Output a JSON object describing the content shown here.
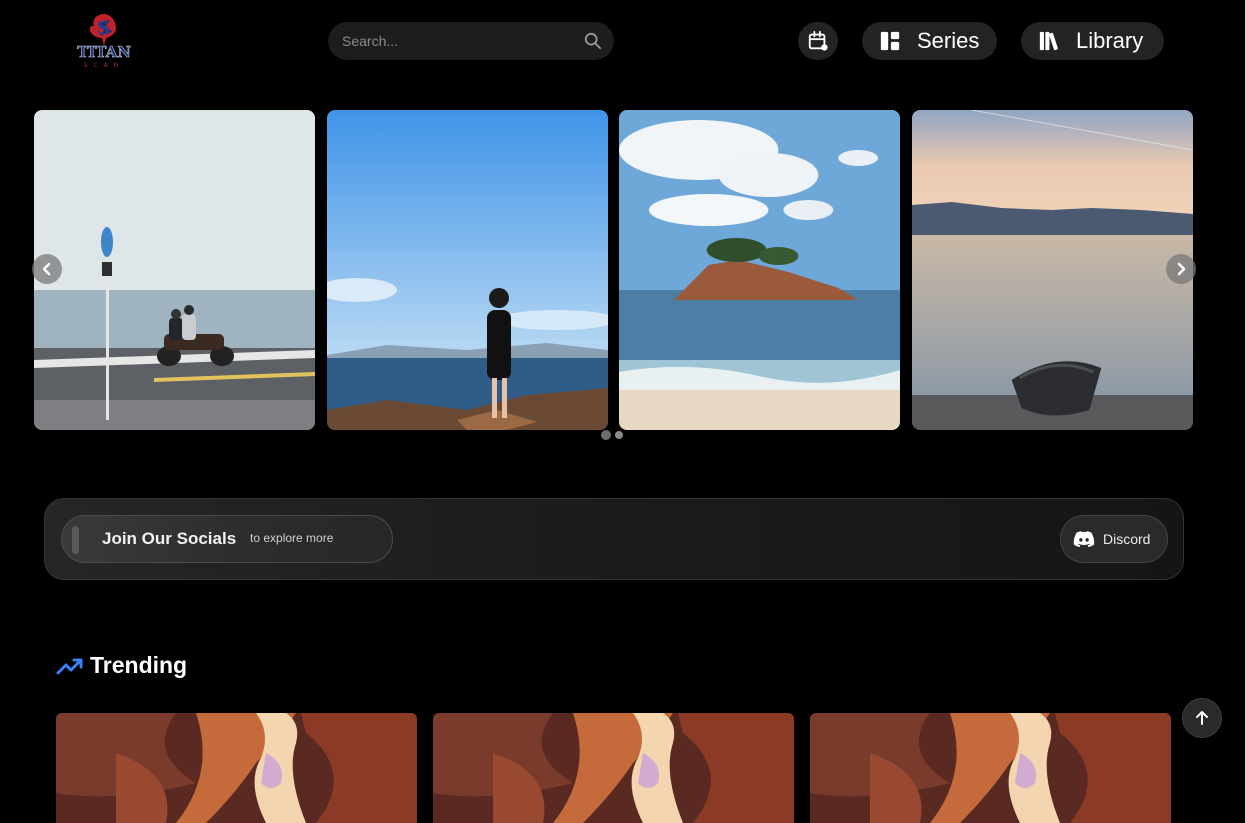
{
  "brand": {
    "logo_text": "TITAN",
    "logo_subtext": "SCAN",
    "logo_colors": {
      "red": "#c0222b",
      "navy": "#1b2f6b"
    }
  },
  "header": {
    "search": {
      "placeholder": "Search..."
    },
    "calendar_icon": "calendar-icon",
    "series_label": "Series",
    "library_label": "Library"
  },
  "carousel": {
    "slides": [
      {
        "subject": "motorcycle-by-sea"
      },
      {
        "subject": "woman-on-rocks"
      },
      {
        "subject": "island-beach"
      },
      {
        "subject": "boat-at-sunset"
      }
    ],
    "page_count": 2,
    "active_page": 1
  },
  "socials": {
    "title": "Join Our Socials",
    "hint": "to explore more",
    "discord_label": "Discord"
  },
  "trending": {
    "title": "Trending",
    "accent_color": "#3b82f6",
    "cards": [
      {
        "subject": "canyon"
      },
      {
        "subject": "canyon"
      },
      {
        "subject": "canyon"
      }
    ]
  }
}
